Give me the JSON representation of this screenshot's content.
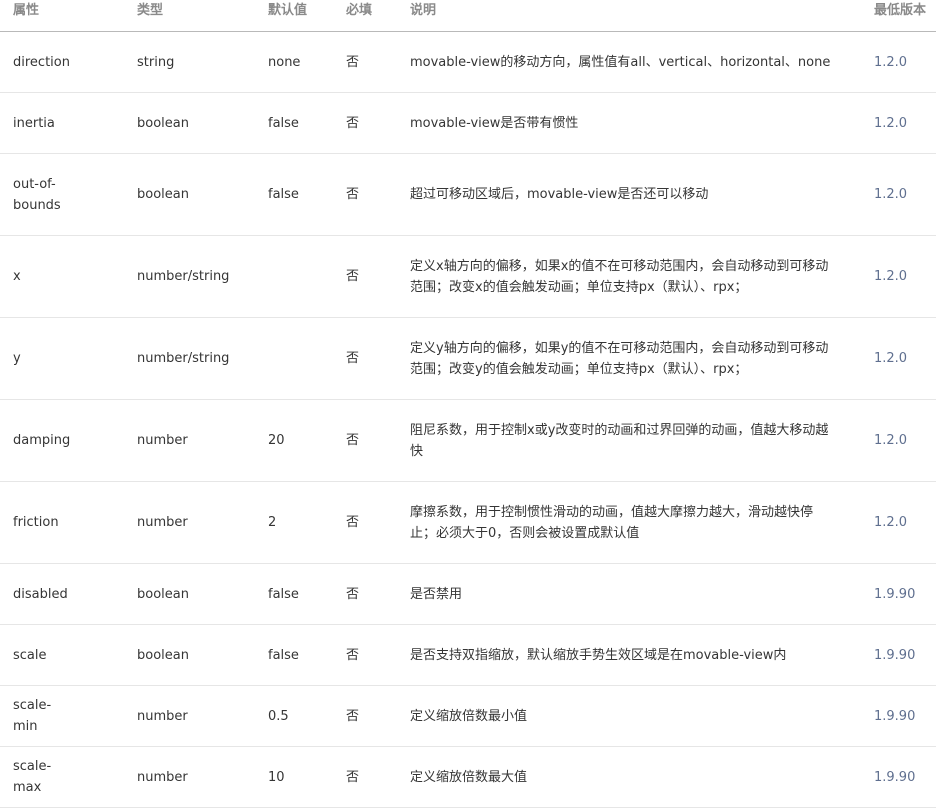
{
  "table": {
    "headers": [
      "属性",
      "类型",
      "默认值",
      "必填",
      "说明",
      "最低版本"
    ],
    "rows": [
      {
        "attr": "direction",
        "type": "string",
        "default": "none",
        "required": "否",
        "desc": "movable-view的移动方向，属性值有all、vertical、horizontal、none",
        "version": "1.2.0"
      },
      {
        "attr": "inertia",
        "type": "boolean",
        "default": "false",
        "required": "否",
        "desc": "movable-view是否带有惯性",
        "version": "1.2.0"
      },
      {
        "attr": "out-of-bounds",
        "type": "boolean",
        "default": "false",
        "required": "否",
        "desc": "超过可移动区域后，movable-view是否还可以移动",
        "version": "1.2.0"
      },
      {
        "attr": "x",
        "type": "number/string",
        "default": "",
        "required": "否",
        "desc": "定义x轴方向的偏移，如果x的值不在可移动范围内，会自动移动到可移动范围；改变x的值会触发动画；单位支持px（默认）、rpx；",
        "version": "1.2.0"
      },
      {
        "attr": "y",
        "type": "number/string",
        "default": "",
        "required": "否",
        "desc": "定义y轴方向的偏移，如果y的值不在可移动范围内，会自动移动到可移动范围；改变y的值会触发动画；单位支持px（默认）、rpx；",
        "version": "1.2.0"
      },
      {
        "attr": "damping",
        "type": "number",
        "default": "20",
        "required": "否",
        "desc": "阻尼系数，用于控制x或y改变时的动画和过界回弹的动画，值越大移动越快",
        "version": "1.2.0"
      },
      {
        "attr": "friction",
        "type": "number",
        "default": "2",
        "required": "否",
        "desc": "摩擦系数，用于控制惯性滑动的动画，值越大摩擦力越大，滑动越快停止；必须大于0，否则会被设置成默认值",
        "version": "1.2.0"
      },
      {
        "attr": "disabled",
        "type": "boolean",
        "default": "false",
        "required": "否",
        "desc": "是否禁用",
        "version": "1.9.90"
      },
      {
        "attr": "scale",
        "type": "boolean",
        "default": "false",
        "required": "否",
        "desc": "是否支持双指缩放，默认缩放手势生效区域是在movable-view内",
        "version": "1.9.90"
      },
      {
        "attr": "scale-min",
        "type": "number",
        "default": "0.5",
        "required": "否",
        "desc": "定义缩放倍数最小值",
        "version": "1.9.90"
      },
      {
        "attr": "scale-max",
        "type": "number",
        "default": "10",
        "required": "否",
        "desc": "定义缩放倍数最大值",
        "version": "1.9.90"
      }
    ]
  }
}
